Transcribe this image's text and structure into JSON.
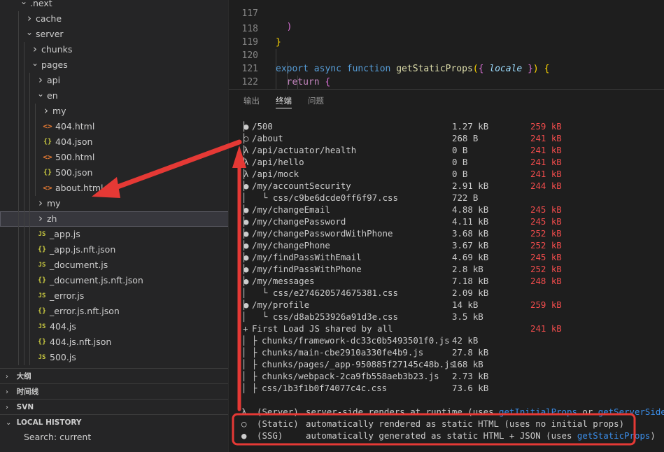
{
  "explorer": {
    "items": [
      {
        "label": ".next",
        "kind": "folder",
        "open": true,
        "depth": 0
      },
      {
        "label": "cache",
        "kind": "folder",
        "open": false,
        "depth": 1
      },
      {
        "label": "server",
        "kind": "folder",
        "open": true,
        "depth": 1
      },
      {
        "label": "chunks",
        "kind": "folder",
        "open": false,
        "depth": 2
      },
      {
        "label": "pages",
        "kind": "folder",
        "open": true,
        "depth": 2
      },
      {
        "label": "api",
        "kind": "folder",
        "open": false,
        "depth": 3
      },
      {
        "label": "en",
        "kind": "folder",
        "open": true,
        "depth": 3
      },
      {
        "label": "my",
        "kind": "folder",
        "open": false,
        "depth": 4
      },
      {
        "label": "404.html",
        "kind": "html",
        "depth": 4
      },
      {
        "label": "404.json",
        "kind": "json",
        "depth": 4
      },
      {
        "label": "500.html",
        "kind": "html",
        "depth": 4
      },
      {
        "label": "500.json",
        "kind": "json",
        "depth": 4
      },
      {
        "label": "about.html",
        "kind": "html",
        "depth": 4
      },
      {
        "label": "my",
        "kind": "folder",
        "open": false,
        "depth": 3
      },
      {
        "label": "zh",
        "kind": "folder",
        "open": false,
        "depth": 3,
        "selected": true
      },
      {
        "label": "_app.js",
        "kind": "js",
        "depth": 3
      },
      {
        "label": "_app.js.nft.json",
        "kind": "json",
        "depth": 3
      },
      {
        "label": "_document.js",
        "kind": "js",
        "depth": 3
      },
      {
        "label": "_document.js.nft.json",
        "kind": "json",
        "depth": 3
      },
      {
        "label": "_error.js",
        "kind": "js",
        "depth": 3
      },
      {
        "label": "_error.js.nft.json",
        "kind": "json",
        "depth": 3
      },
      {
        "label": "404.js",
        "kind": "js",
        "depth": 3
      },
      {
        "label": "404.js.nft.json",
        "kind": "json",
        "depth": 3
      },
      {
        "label": "500.js",
        "kind": "js",
        "depth": 3
      }
    ],
    "icons": {
      "html": "<>",
      "json": "{}",
      "js": "JS"
    }
  },
  "sections": [
    {
      "label": "大纲",
      "open": false
    },
    {
      "label": "时间线",
      "open": false
    },
    {
      "label": "SVN",
      "open": false
    },
    {
      "label": "LOCAL HISTORY",
      "open": true
    }
  ],
  "local_history_item": "Search: current",
  "editor": {
    "lines": [
      {
        "n": "117"
      },
      {
        "n": "118"
      },
      {
        "n": "119"
      },
      {
        "n": "120"
      },
      {
        "n": "121"
      },
      {
        "n": "122"
      },
      {
        "n": "123"
      }
    ]
  },
  "panel": {
    "tabs": [
      {
        "label": "输出",
        "active": false
      },
      {
        "label": "终端",
        "active": true
      },
      {
        "label": "问题",
        "active": false
      }
    ]
  },
  "terminal": {
    "routes": [
      {
        "sym": "●",
        "route": "/500",
        "size": "1.27 kB",
        "first": "259 kB"
      },
      {
        "sym": "○",
        "route": "/about",
        "size": "268 B",
        "first": "241 kB"
      },
      {
        "sym": "λ",
        "route": "/api/actuator/health",
        "size": "0 B",
        "first": "241 kB"
      },
      {
        "sym": "λ",
        "route": "/api/hello",
        "size": "0 B",
        "first": "241 kB"
      },
      {
        "sym": "λ",
        "route": "/api/mock",
        "size": "0 B",
        "first": "241 kB"
      },
      {
        "sym": "●",
        "route": "/my/accountSecurity",
        "size": "2.91 kB",
        "first": "244 kB"
      },
      {
        "sub": "└ css/c9be6dcde0ff6f97.css",
        "size": "722 B"
      },
      {
        "sym": "●",
        "route": "/my/changeEmail",
        "size": "4.88 kB",
        "first": "245 kB"
      },
      {
        "sym": "●",
        "route": "/my/changePassword",
        "size": "4.11 kB",
        "first": "245 kB"
      },
      {
        "sym": "●",
        "route": "/my/changePasswordWithPhone",
        "size": "3.68 kB",
        "first": "252 kB"
      },
      {
        "sym": "●",
        "route": "/my/changePhone",
        "size": "3.67 kB",
        "first": "252 kB"
      },
      {
        "sym": "●",
        "route": "/my/findPassWithEmail",
        "size": "4.69 kB",
        "first": "245 kB"
      },
      {
        "sym": "●",
        "route": "/my/findPassWithPhone",
        "size": "2.8 kB",
        "first": "252 kB"
      },
      {
        "sym": "●",
        "route": "/my/messages",
        "size": "7.18 kB",
        "first": "248 kB"
      },
      {
        "sub": "└ css/e274620574675381.css",
        "size": "2.09 kB"
      },
      {
        "sym": "●",
        "route": "/my/profile",
        "size": "14 kB",
        "first": "259 kB"
      },
      {
        "sub": "└ css/d8ab253926a91d3e.css",
        "size": "3.5 kB"
      }
    ],
    "shared_title": "First Load JS shared by all",
    "shared_size": "241 kB",
    "shared": [
      {
        "name": "chunks/framework-dc33c0b5493501f0.js",
        "size": "42 kB"
      },
      {
        "name": "chunks/main-cbe2910a330fe4b9.js",
        "size": "27.8 kB"
      },
      {
        "name": "chunks/pages/_app-950885f27145c48b.js",
        "size": "168 kB"
      },
      {
        "name": "chunks/webpack-2ca9fb558aeb3b23.js",
        "size": "2.73 kB"
      },
      {
        "name": "css/1b3f1b0f74077c4c.css",
        "size": "73.6 kB"
      }
    ],
    "legend": [
      {
        "sym": "λ",
        "kind": "(Server)",
        "desc": "server-side renders at runtime (uses ",
        "link1": "getInitialProps",
        "mid": " or ",
        "link2": "getServerSideProps",
        "end": ")"
      },
      {
        "sym": "○",
        "kind": "(Static)",
        "desc": "automatically rendered as static HTML (uses no initial props)"
      },
      {
        "sym": "●",
        "kind": "(SSG)",
        "desc": "automatically generated as static HTML + JSON (uses ",
        "link1": "getStaticProps",
        "end": ")"
      }
    ]
  },
  "colors": {
    "annotation": "#e53935",
    "link": "#3b8eea",
    "first_load": "#f14c4c"
  }
}
